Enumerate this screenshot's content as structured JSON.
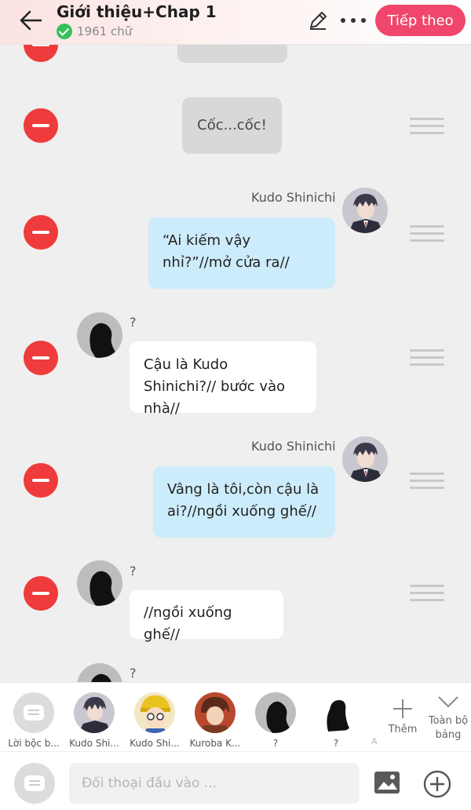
{
  "header": {
    "title": "Giới thiệu+Chap 1",
    "word_count": "1961 chữ",
    "next_label": "Tiếp theo"
  },
  "messages": [
    {
      "type": "narration",
      "text": ""
    },
    {
      "type": "narration",
      "text": "Cốc...cốc!"
    },
    {
      "type": "right",
      "speaker": "Kudo Shinichi",
      "text": "“Ai kiếm vậy nhỉ?”//mở cửa ra//"
    },
    {
      "type": "left",
      "speaker": "?",
      "text": "Cậu là Kudo Shinichi?// bước vào nhà//"
    },
    {
      "type": "right",
      "speaker": "Kudo Shinichi",
      "text": "Vâng là tôi,còn cậu là ai?//ngồi xuống ghế//"
    },
    {
      "type": "left",
      "speaker": "?",
      "text": "//ngồi xuống ghế//"
    },
    {
      "type": "left",
      "speaker": "?",
      "text": ""
    }
  ],
  "characters": [
    {
      "label": "Lời bộc b..."
    },
    {
      "label": "Kudo Shi..."
    },
    {
      "label": "Kudo Shi..."
    },
    {
      "label": "Kuroba K..."
    },
    {
      "label": "?"
    },
    {
      "label": "?"
    }
  ],
  "extra_label_a": "A",
  "add_label": "Thêm",
  "collapse_label": "Toàn bộ bảng",
  "input": {
    "placeholder": "Đối thoại đầu vào ..."
  },
  "colors": {
    "accent": "#f0466b",
    "delete": "#ef3b3b",
    "right_bubble": "#cdecfb",
    "narration_bubble": "#d8d8d8"
  },
  "icons": [
    "back-arrow-icon",
    "pencil-icon",
    "more-icon",
    "check-icon",
    "minus-icon",
    "drag-handle-icon",
    "plus-icon",
    "chevron-down-icon",
    "image-icon",
    "add-circle-icon",
    "narration-icon"
  ]
}
